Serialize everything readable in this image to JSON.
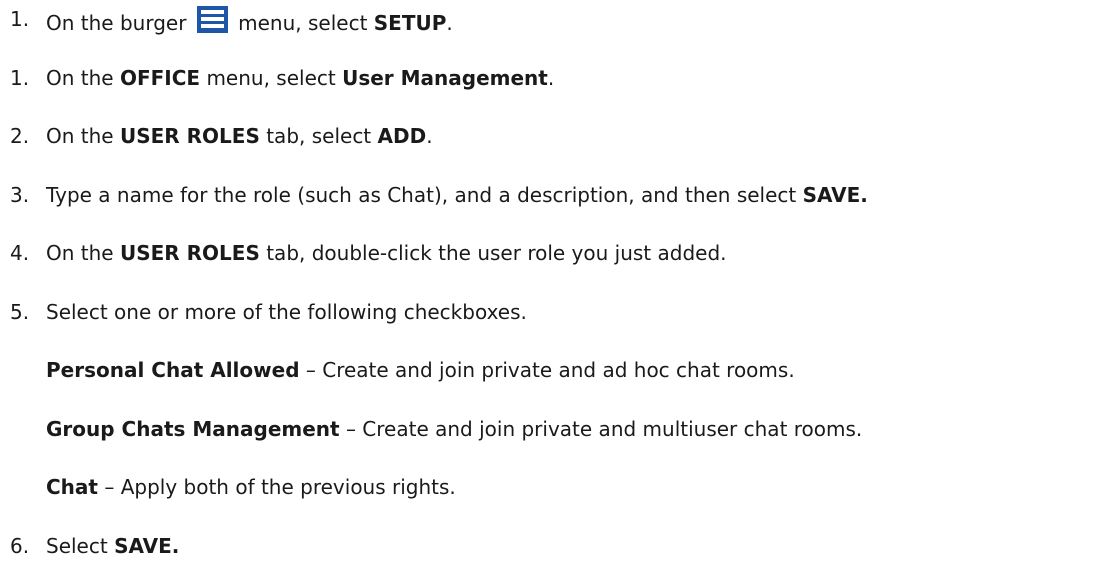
{
  "steps": [
    {
      "num": "1.",
      "parts": [
        "On the burger",
        "menu, select",
        "SETUP",
        "."
      ]
    },
    {
      "num": "1.",
      "parts": [
        "On the",
        "OFFICE",
        "menu, select",
        "User Management",
        "."
      ]
    },
    {
      "num": "2.",
      "parts": [
        "On the",
        "USER ROLES",
        "tab, select",
        "ADD",
        "."
      ]
    },
    {
      "num": "3.",
      "parts": [
        "Type a name for the role (such as Chat), and a description, and then select",
        "SAVE."
      ]
    },
    {
      "num": "4.",
      "parts": [
        "On the",
        "USER ROLES",
        "tab, double-click the user role you just added."
      ]
    },
    {
      "num": "5.",
      "parts": [
        "Select one or more of the following checkboxes."
      ]
    },
    {
      "num": "6.",
      "parts": [
        "Select",
        "SAVE."
      ]
    }
  ],
  "checkbox_options": [
    {
      "name": "Personal Chat Allowed",
      "desc": " – Create and join private and ad hoc chat rooms."
    },
    {
      "name": "Group Chats Management",
      "desc": " – Create and join private and multiuser chat rooms."
    },
    {
      "name": "Chat",
      "desc": " – Apply both of the previous rights."
    }
  ],
  "icons": {
    "burger": "burger-menu-icon",
    "burger_color": "#1f57a8"
  }
}
